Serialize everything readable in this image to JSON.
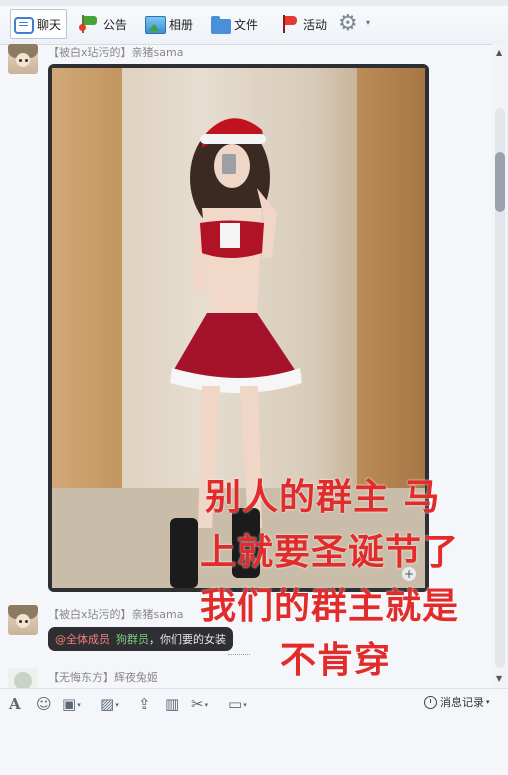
{
  "toolbar": {
    "tabs": [
      {
        "label": "聊天",
        "icon": "chat-icon"
      },
      {
        "label": "公告",
        "icon": "notice-flag-icon"
      },
      {
        "label": "相册",
        "icon": "album-icon"
      },
      {
        "label": "文件",
        "icon": "folder-icon"
      },
      {
        "label": "活动",
        "icon": "activity-flag-icon"
      }
    ],
    "settings_icon": "gear-icon"
  },
  "messages": [
    {
      "sender": "【被白x玷污的】亲猪sama",
      "type": "image"
    },
    {
      "sender": "【被白x玷污的】亲猪sama",
      "at": "@全体成员",
      "mention": "狗群员",
      "text": "，你们要的女装"
    },
    {
      "sender": "【无悔东方】辉夜兔姬"
    }
  ],
  "overlay_text": {
    "line1": "别人的群主  马",
    "line2": "上就要圣诞节了",
    "line3": "我们的群主就是",
    "line4": "不肯穿"
  },
  "bottom_toolbar": {
    "history_label": "消息记录",
    "icons": [
      "font-icon",
      "emoji-icon",
      "shake-icon",
      "image-icon",
      "upload-icon",
      "gift-icon",
      "screenshot-icon",
      "voice-icon"
    ]
  },
  "colors": {
    "overlay_red": "#e22b2b",
    "bubble_bg": "#2f2f33",
    "at_color": "#f08080",
    "mention_color": "#7fc97f"
  }
}
